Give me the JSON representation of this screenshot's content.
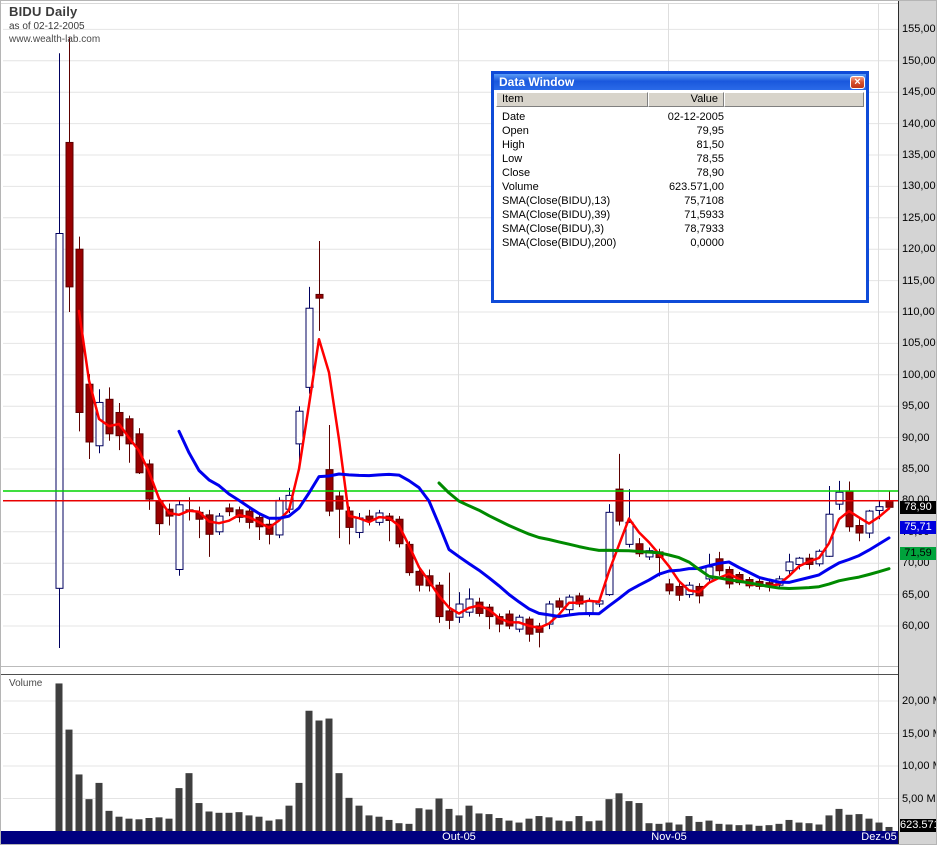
{
  "header": {
    "title": "BIDU Daily",
    "subtitle": "as of 02-12-2005",
    "website": "www.wealth-lab.com"
  },
  "volume_pane": {
    "label": "Volume"
  },
  "data_window": {
    "title": "Data Window",
    "columns": [
      "Item",
      "Value"
    ],
    "rows": [
      [
        "Date",
        "02-12-2005"
      ],
      [
        "Open",
        "79,95"
      ],
      [
        "High",
        "81,50"
      ],
      [
        "Low",
        "78,55"
      ],
      [
        "Close",
        "78,90"
      ],
      [
        "Volume",
        "623.571,00"
      ],
      [
        "SMA(Close(BIDU),13)",
        "75,7108"
      ],
      [
        "SMA(Close(BIDU),39)",
        "71,5933"
      ],
      [
        "SMA(Close(BIDU),3)",
        "78,7933"
      ],
      [
        "SMA(Close(BIDU),200)",
        "0,0000"
      ]
    ]
  },
  "chart_data": {
    "type": "candlestick+volume",
    "symbol": "BIDU",
    "timeframe": "Daily",
    "price_axis": {
      "min": 60,
      "max": 155,
      "step": 5
    },
    "volume_axis": {
      "ticks_m": [
        20,
        15,
        10,
        5
      ]
    },
    "month_labels": [
      {
        "label": "Out-05",
        "index": 40
      },
      {
        "label": "Nov-05",
        "index": 61
      },
      {
        "label": "Dez-05",
        "index": 82
      }
    ],
    "hlines": [
      {
        "name": "high-line",
        "value": 81.5,
        "color": "#00d300"
      },
      {
        "name": "open-line",
        "value": 79.95,
        "color": "#e80000"
      }
    ],
    "sma": [
      {
        "period": 3,
        "color": "#ff0000",
        "width": 2.5
      },
      {
        "period": 13,
        "color": "#0000ee",
        "width": 3
      },
      {
        "period": 39,
        "color": "#008a00",
        "width": 3
      }
    ],
    "colors": {
      "up_fill": "#ffffff",
      "up_border": "#00005f",
      "down_fill": "#990000",
      "down_border": "#5c0000",
      "volume": "#3f3f3f",
      "grid": "#e4e4e4",
      "date_bar": "#000080",
      "axis_bg": "#d4d4d4"
    },
    "last_values": {
      "close": "78,90",
      "sma13": "75,71",
      "sma39": "71,59",
      "volume": "623.571"
    },
    "last_values_num": {
      "close": 78.9,
      "sma13": 75.71,
      "sma39": 71.59
    },
    "candles": [
      [
        66,
        151.2,
        56.5,
        122.5
      ],
      [
        137,
        153.7,
        110,
        114
      ],
      [
        120,
        122,
        91,
        94
      ],
      [
        98.5,
        100.1,
        86.6,
        89.3
      ],
      [
        88.7,
        97.7,
        87.5,
        95.6
      ],
      [
        96.1,
        98,
        89.5,
        90.6
      ],
      [
        94,
        95.5,
        88,
        90.3
      ],
      [
        93,
        93.5,
        86,
        89
      ],
      [
        90.6,
        91.5,
        84.2,
        84.4
      ],
      [
        85.8,
        86.5,
        78.5,
        80.2
      ],
      [
        79.9,
        80.5,
        74.5,
        76.3
      ],
      [
        78.6,
        79.5,
        76,
        77.5
      ],
      [
        69,
        80,
        68,
        79.3
      ],
      [
        78.5,
        80.5,
        76.8,
        78.3
      ],
      [
        78.1,
        79,
        74,
        77
      ],
      [
        77.7,
        78.5,
        71,
        74.6
      ],
      [
        75,
        78,
        74.5,
        77.5
      ],
      [
        78.8,
        79.5,
        77.5,
        78.2
      ],
      [
        78.5,
        79,
        76.5,
        77.3
      ],
      [
        78.3,
        79,
        75.5,
        76.5
      ],
      [
        77.3,
        78,
        73.7,
        75.8
      ],
      [
        76.2,
        77,
        73,
        74.6
      ],
      [
        74.5,
        80.5,
        74,
        80
      ],
      [
        78.6,
        82,
        78,
        80.8
      ],
      [
        89,
        95,
        86,
        94.2
      ],
      [
        98,
        114,
        97,
        110.6
      ],
      [
        112.8,
        121.3,
        107,
        112.2
      ],
      [
        84.9,
        92,
        77.5,
        78.3
      ],
      [
        80.7,
        81.5,
        74,
        78.6
      ],
      [
        78.3,
        79,
        73,
        75.7
      ],
      [
        74.9,
        78,
        74,
        77.2
      ],
      [
        77.5,
        78.5,
        76,
        76.8
      ],
      [
        76.5,
        78.5,
        76,
        78
      ],
      [
        77.5,
        78,
        73.5,
        76.8
      ],
      [
        77,
        77.5,
        72.5,
        73.1
      ],
      [
        73,
        73.5,
        68,
        68.5
      ],
      [
        68.7,
        69.5,
        65.5,
        66.5
      ],
      [
        68,
        69,
        65.5,
        66.4
      ],
      [
        66.5,
        67,
        60.5,
        61.5
      ],
      [
        62.4,
        68.5,
        59.5,
        60.9
      ],
      [
        61.4,
        65.4,
        60.5,
        63.5
      ],
      [
        62.2,
        66,
        61.5,
        64.3
      ],
      [
        63.8,
        64.5,
        61.5,
        62
      ],
      [
        63,
        63.5,
        59.5,
        61.5
      ],
      [
        61.5,
        62,
        59,
        60.3
      ],
      [
        61.9,
        62.5,
        59.5,
        60
      ],
      [
        59.5,
        61.8,
        59,
        61.4
      ],
      [
        61.1,
        61.5,
        57.5,
        58.7
      ],
      [
        60,
        60.5,
        56.6,
        59
      ],
      [
        60.3,
        64,
        59.5,
        63.5
      ],
      [
        64,
        64.5,
        62.5,
        63
      ],
      [
        62.6,
        65,
        62,
        64.6
      ],
      [
        64.8,
        65.3,
        63,
        63.5
      ],
      [
        61.9,
        64.5,
        61.5,
        64
      ],
      [
        63.5,
        64.5,
        63,
        64
      ],
      [
        65,
        79.4,
        64.8,
        78.1
      ],
      [
        81.8,
        87.4,
        76,
        76.7
      ],
      [
        73,
        81.8,
        72.5,
        76.5
      ],
      [
        73.1,
        74,
        71,
        71.5
      ],
      [
        71,
        72.5,
        70.5,
        72
      ],
      [
        71.8,
        72.3,
        67.9,
        70.9
      ],
      [
        66.7,
        67.5,
        65,
        65.6
      ],
      [
        66.3,
        66.8,
        64,
        64.9
      ],
      [
        65,
        67,
        64.5,
        66.5
      ],
      [
        66.3,
        66.8,
        63.6,
        64.8
      ],
      [
        67.5,
        71.5,
        67,
        69.4
      ],
      [
        70.7,
        71.8,
        68,
        68.8
      ],
      [
        69,
        69.5,
        66,
        66.7
      ],
      [
        68.2,
        68.6,
        66.5,
        66.9
      ],
      [
        67.4,
        67.8,
        66,
        66.4
      ],
      [
        67.1,
        67.5,
        65.8,
        66.3
      ],
      [
        66.9,
        67.3,
        65.5,
        66.2
      ],
      [
        66.5,
        68,
        66,
        67.5
      ],
      [
        68.8,
        71.5,
        68,
        70.2
      ],
      [
        69.8,
        71,
        69,
        70.8
      ],
      [
        70.8,
        71.5,
        69,
        69.8
      ],
      [
        69.9,
        72.2,
        69.5,
        71.9
      ],
      [
        71.1,
        82.3,
        71,
        77.8
      ],
      [
        79.4,
        83.1,
        78.5,
        81.3
      ],
      [
        81.5,
        83,
        75,
        75.8
      ],
      [
        76,
        77,
        73.5,
        74.8
      ],
      [
        74.8,
        78.5,
        74,
        78.3
      ],
      [
        78.4,
        80,
        77,
        79
      ],
      [
        79.95,
        81.5,
        78.55,
        78.9
      ]
    ],
    "volumes_m": [
      22.7,
      15.6,
      8.7,
      4.9,
      7.4,
      3.1,
      2.2,
      1.9,
      1.8,
      2.0,
      2.1,
      1.9,
      6.6,
      8.9,
      4.3,
      3.0,
      2.8,
      2.8,
      2.9,
      2.4,
      2.2,
      1.6,
      1.8,
      3.9,
      7.4,
      18.5,
      17.0,
      17.3,
      8.9,
      5.1,
      3.9,
      2.4,
      2.2,
      1.7,
      1.2,
      1.1,
      3.5,
      3.3,
      5.0,
      3.4,
      2.4,
      3.9,
      2.7,
      2.6,
      2.0,
      1.6,
      1.3,
      1.9,
      2.3,
      2.1,
      1.6,
      1.5,
      2.3,
      1.5,
      1.6,
      4.9,
      5.8,
      4.6,
      4.3,
      1.2,
      1.1,
      1.3,
      1.0,
      2.3,
      1.4,
      1.6,
      1.1,
      1.0,
      0.9,
      1.0,
      0.8,
      0.9,
      1.1,
      1.7,
      1.3,
      1.2,
      1.0,
      2.4,
      3.4,
      2.5,
      2.6,
      1.9,
      1.3,
      0.62
    ]
  }
}
